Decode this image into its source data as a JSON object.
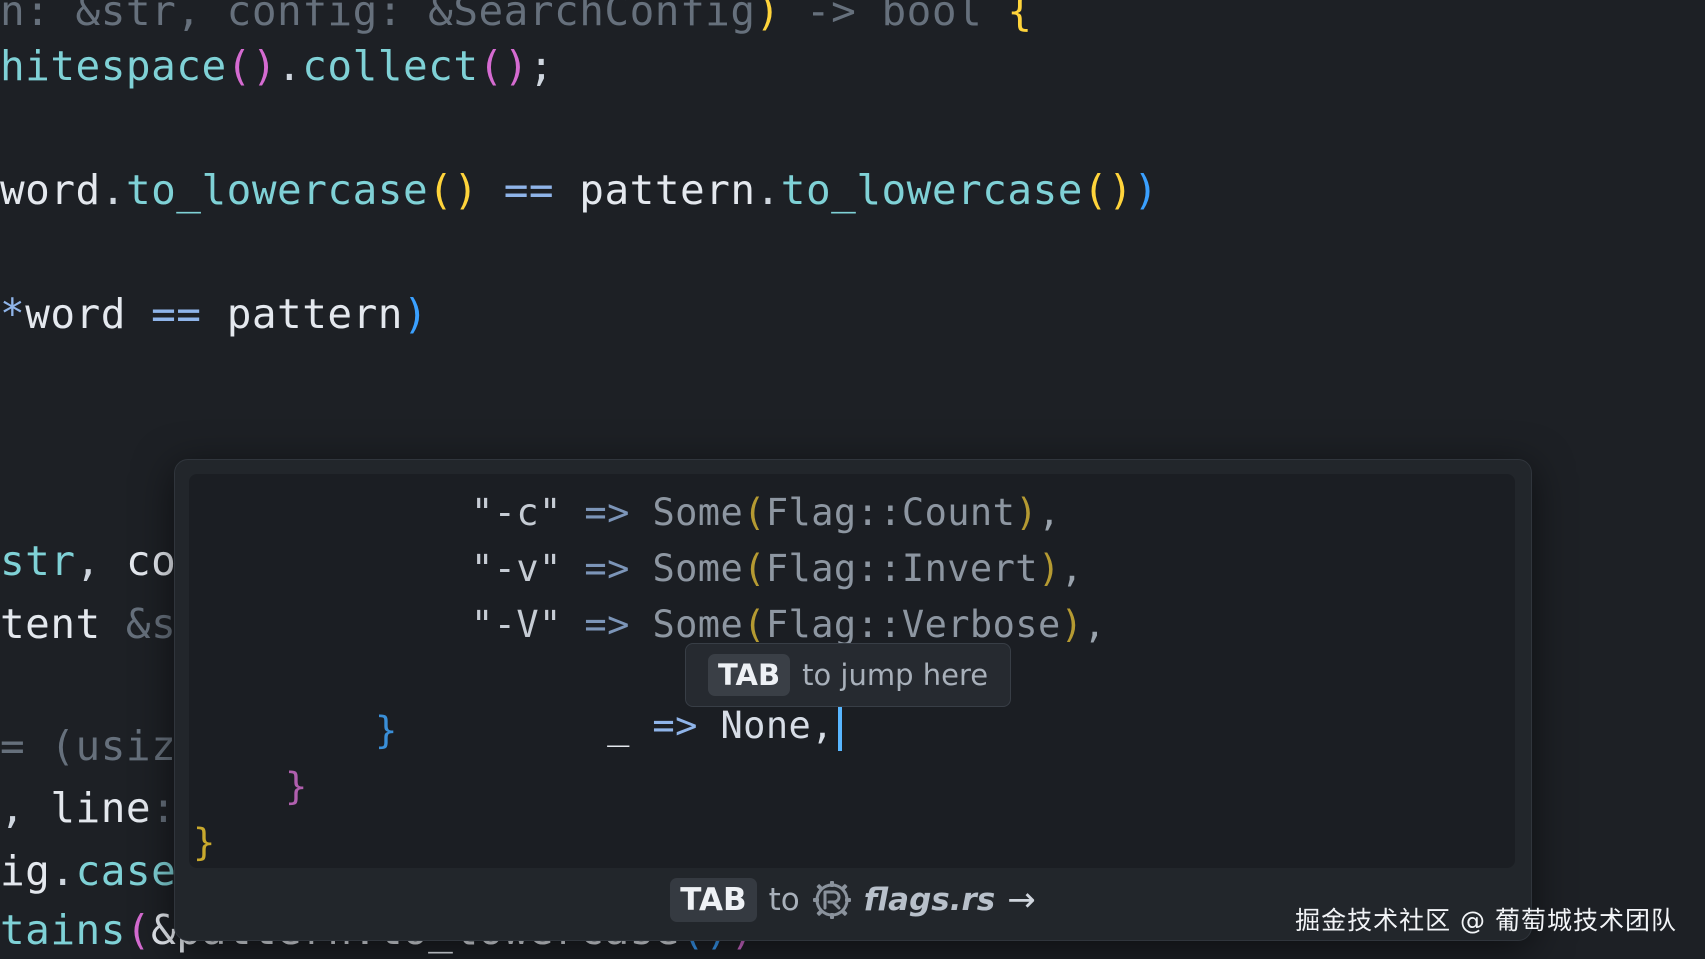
{
  "editor": {
    "background_lines": [
      {
        "segments": [
          {
            "t": "n: &str, config: &SearchConfig",
            "c": "c-dim"
          },
          {
            "t": ") ",
            "c": "p-yellow"
          },
          {
            "t": "-> ",
            "c": "c-dim"
          },
          {
            "t": "bool ",
            "c": "c-dim"
          },
          {
            "t": "{",
            "c": "p-yellow"
          }
        ]
      },
      {
        "segments": [
          {
            "t": "hitespace",
            "c": "c-fn"
          },
          {
            "t": "()",
            "c": "p-magenta"
          },
          {
            "t": ".",
            "c": "c-punc"
          },
          {
            "t": "collect",
            "c": "c-fn"
          },
          {
            "t": "()",
            "c": "p-magenta"
          },
          {
            "t": ";",
            "c": "c-punc"
          }
        ]
      },
      {
        "segments": [
          {
            "t": "word",
            "c": "c-plain"
          },
          {
            "t": ".",
            "c": "c-punc"
          },
          {
            "t": "to_lowercase",
            "c": "c-fn"
          },
          {
            "t": "()",
            "c": "p-yellow"
          },
          {
            "t": " == ",
            "c": "c-op"
          },
          {
            "t": "pattern",
            "c": "c-plain"
          },
          {
            "t": ".",
            "c": "c-punc"
          },
          {
            "t": "to_lowercase",
            "c": "c-fn"
          },
          {
            "t": "()",
            "c": "p-yellow"
          },
          {
            "t": ")",
            "c": "p-blue"
          }
        ]
      },
      {
        "segments": [
          {
            "t": "*",
            "c": "c-op"
          },
          {
            "t": "word",
            "c": "c-plain"
          },
          {
            "t": " == ",
            "c": "c-op"
          },
          {
            "t": "pattern",
            "c": "c-plain"
          },
          {
            "t": ")",
            "c": "p-blue"
          }
        ]
      },
      {
        "segments": [
          {
            "t": "str",
            "c": "c-type"
          },
          {
            "t": ", ",
            "c": "c-punc"
          },
          {
            "t": "cor",
            "c": "c-plain"
          }
        ]
      },
      {
        "segments": [
          {
            "t": "tent ",
            "c": "c-plain"
          },
          {
            "t": "&st",
            "c": "c-dim"
          }
        ]
      },
      {
        "segments": [
          {
            "t": "= (usiz",
            "c": "c-dim"
          }
        ]
      },
      {
        "segments": [
          {
            "t": ", ",
            "c": "c-punc"
          },
          {
            "t": "line",
            "c": "c-plain"
          },
          {
            "t": ":",
            "c": "c-dim"
          }
        ]
      },
      {
        "segments": [
          {
            "t": "ig",
            "c": "c-plain"
          },
          {
            "t": ".",
            "c": "c-punc"
          },
          {
            "t": "case_",
            "c": "c-fn"
          }
        ]
      },
      {
        "segments": [
          {
            "t": "tains",
            "c": "c-fn"
          },
          {
            "t": "(",
            "c": "p-magenta"
          },
          {
            "t": "&pattern.to_lowercase",
            "c": "c-plain"
          },
          {
            "t": "()",
            "c": "p-blue"
          },
          {
            "t": ")",
            "c": "p-magenta"
          }
        ]
      }
    ]
  },
  "suggestion_popup": {
    "lines": [
      {
        "segments": [
          {
            "t": "\"-c\"",
            "c": "s"
          },
          {
            "t": " => ",
            "c": "o"
          },
          {
            "t": "Some",
            "c": "w"
          },
          {
            "t": "(",
            "c": "y"
          },
          {
            "t": "Flag::Count",
            "c": "w"
          },
          {
            "t": ")",
            "c": "y"
          },
          {
            "t": ",",
            "c": "pu"
          }
        ]
      },
      {
        "segments": [
          {
            "t": "\"-v\"",
            "c": "s"
          },
          {
            "t": " => ",
            "c": "o"
          },
          {
            "t": "Some",
            "c": "w"
          },
          {
            "t": "(",
            "c": "y"
          },
          {
            "t": "Flag::Invert",
            "c": "w"
          },
          {
            "t": ")",
            "c": "y"
          },
          {
            "t": ",",
            "c": "pu"
          }
        ]
      },
      {
        "segments": [
          {
            "t": "\"-V\"",
            "c": "s"
          },
          {
            "t": " => ",
            "c": "o"
          },
          {
            "t": "Some",
            "c": "w"
          },
          {
            "t": "(",
            "c": "y"
          },
          {
            "t": "Flag::Verbose",
            "c": "w"
          },
          {
            "t": ")",
            "c": "y"
          },
          {
            "t": ",",
            "c": "pu"
          }
        ]
      }
    ],
    "current_line": {
      "underscore": "_",
      "arrow": " => ",
      "value": "None,"
    },
    "closing_braces": [
      "}",
      "}",
      "}"
    ],
    "jump_hint": {
      "key": "TAB",
      "text": "to jump here"
    },
    "footer": {
      "key": "TAB",
      "to_text": "to",
      "icon": "rust-logo-icon",
      "filename": "flags.rs",
      "arrow": "→"
    }
  },
  "watermark": "掘金技术社区 @ 葡萄城技术团队",
  "colors": {
    "background": "#1d2025",
    "popup": "#22262b",
    "cursor": "#58b6ff",
    "paren_yellow": "#ffd43b",
    "paren_magenta": "#d56bd1",
    "paren_blue": "#3aa0ff"
  }
}
